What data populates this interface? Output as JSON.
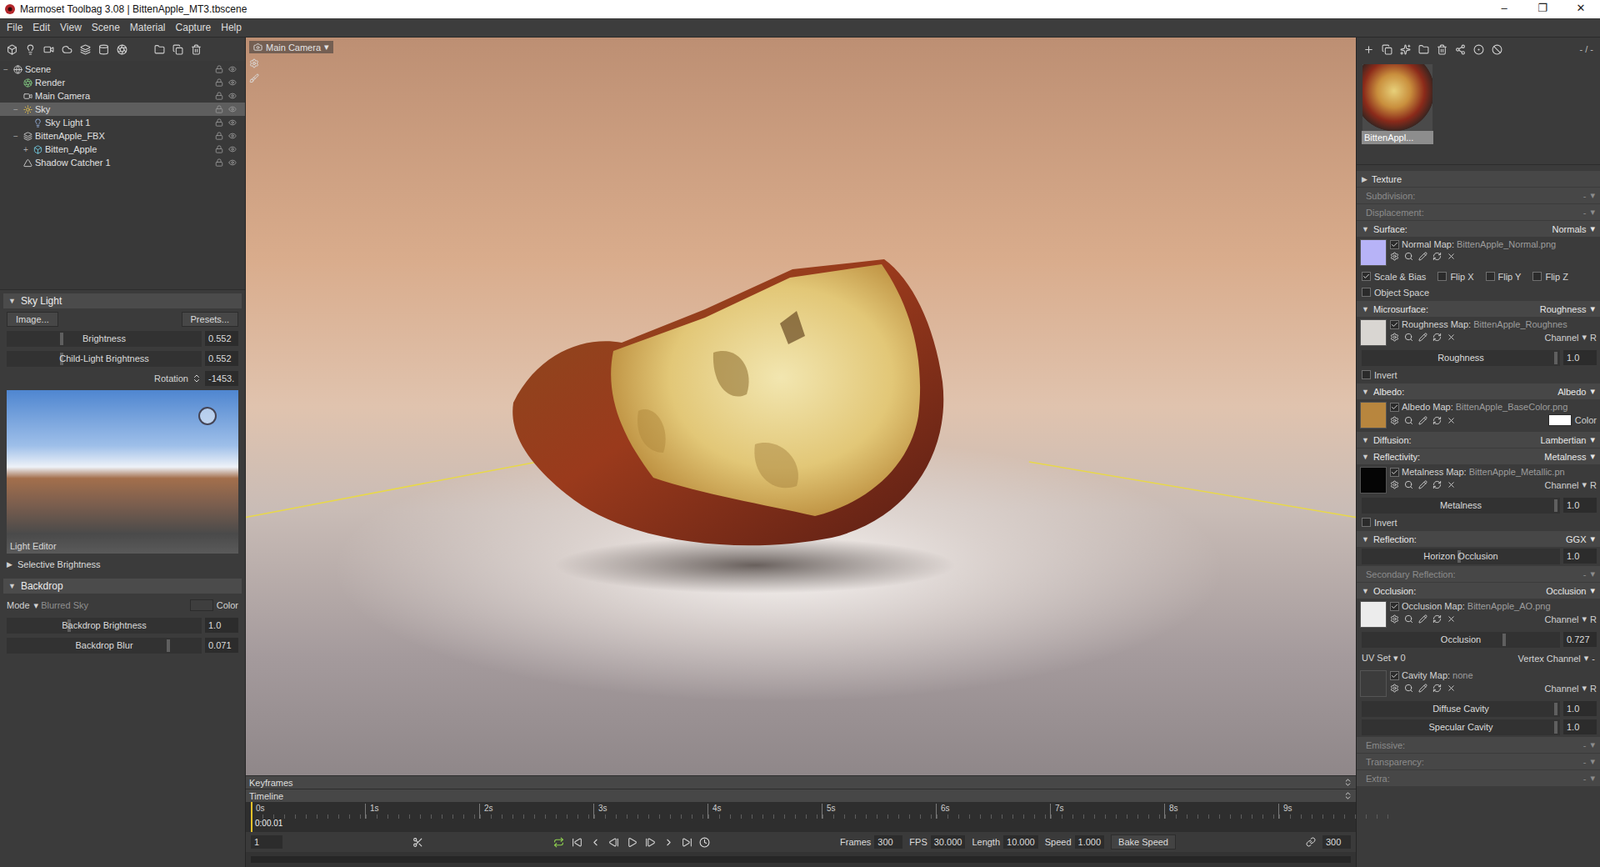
{
  "window": {
    "title": "Marmoset Toolbag 3.08 | BittenApple_MT3.tbscene",
    "controls": [
      "–",
      "❐",
      "✕"
    ]
  },
  "menu": [
    "File",
    "Edit",
    "View",
    "Scene",
    "Material",
    "Capture",
    "Help"
  ],
  "scene_tree": [
    {
      "label": "Scene",
      "depth": 0,
      "kind": "scene",
      "expander": "−",
      "selected": false
    },
    {
      "label": "Render",
      "depth": 1,
      "kind": "render",
      "expander": "",
      "selected": false
    },
    {
      "label": "Main Camera",
      "depth": 1,
      "kind": "camera",
      "expander": "",
      "selected": false
    },
    {
      "label": "Sky",
      "depth": 1,
      "kind": "sky",
      "expander": "−",
      "selected": true
    },
    {
      "label": "Sky Light 1",
      "depth": 2,
      "kind": "light",
      "expander": "",
      "selected": false
    },
    {
      "label": "BittenApple_FBX",
      "depth": 1,
      "kind": "group",
      "expander": "−",
      "selected": false
    },
    {
      "label": "Bitten_Apple",
      "depth": 2,
      "kind": "mesh",
      "expander": "+",
      "selected": false
    },
    {
      "label": "Shadow Catcher 1",
      "depth": 1,
      "kind": "shadow",
      "expander": "",
      "selected": false
    }
  ],
  "sky_light": {
    "arrow": "▼",
    "title": "Sky Light",
    "image_button": "Image...",
    "presets_button": "Presets...",
    "sliders": [
      {
        "label": "Brightness",
        "value": "0.552",
        "level": 0.28
      },
      {
        "label": "Child-Light Brightness",
        "value": "0.552",
        "level": 0.28
      }
    ],
    "rotation": {
      "label": "Rotation",
      "value": "-1453."
    },
    "preview_caption": "Light Editor",
    "selective": {
      "arrow": "▶",
      "label": "Selective Brightness",
      "expanded": false
    }
  },
  "backdrop": {
    "arrow": "▼",
    "title": "Backdrop",
    "mode_label": "Mode",
    "mode_arrow": "▾",
    "mode_value": "Blurred Sky",
    "color_label": "Color",
    "sliders": [
      {
        "label": "Backdrop Brightness",
        "value": "1.0",
        "level": 0.32
      },
      {
        "label": "Backdrop Blur",
        "value": "0.071",
        "level": 0.83
      }
    ]
  },
  "viewport": {
    "camera": "Main Camera",
    "camera_arrow": "▾"
  },
  "timeline": {
    "keyframes_label": "Keyframes",
    "timeline_label": "Timeline",
    "ticks": [
      "0s",
      "1s",
      "2s",
      "3s",
      "4s",
      "5s",
      "6s",
      "7s",
      "8s",
      "9s"
    ],
    "current": "0:00.01",
    "playhead_level": 0.0,
    "frame": "1",
    "fields": [
      {
        "label": "Frames",
        "value": "300"
      },
      {
        "label": "FPS",
        "value": "30.000"
      },
      {
        "label": "Length",
        "value": "10.000"
      },
      {
        "label": "Speed",
        "value": "1.000"
      }
    ],
    "bake_button": "Bake Speed",
    "end_frame": "300"
  },
  "material": {
    "page": "- / -",
    "name": "BittenAppl...",
    "selected": true,
    "channel_label": "Channel",
    "dropdown": "▾",
    "sections": [
      {
        "arrow": "▶",
        "label": "Texture",
        "value": "",
        "dropdown": "",
        "disabled": false,
        "rows": []
      },
      {
        "arrow": "",
        "label": "Subdivision:",
        "value": "-",
        "dropdown": "▾",
        "disabled": true,
        "rows": []
      },
      {
        "arrow": "",
        "label": "Displacement:",
        "value": "-",
        "dropdown": "▾",
        "disabled": true,
        "rows": []
      },
      {
        "arrow": "▼",
        "label": "Surface:",
        "value": "Normals",
        "dropdown": "▾",
        "disabled": false,
        "rows": [
          {
            "kind": "map",
            "label": "Normal Map:",
            "file": "BittenApple_Normal.png",
            "enabled": true,
            "color": "#b7b3f7",
            "channel": null,
            "swatch": null
          },
          {
            "kind": "checks",
            "items": [
              {
                "label": "Scale & Bias",
                "checked": true
              },
              {
                "label": "Flip X",
                "checked": false
              },
              {
                "label": "Flip Y",
                "checked": false
              },
              {
                "label": "Flip Z",
                "checked": false
              }
            ]
          },
          {
            "kind": "checks",
            "items": [
              {
                "label": "Object Space",
                "checked": false
              }
            ]
          }
        ]
      },
      {
        "arrow": "▼",
        "label": "Microsurface:",
        "value": "Roughness",
        "dropdown": "▾",
        "disabled": false,
        "rows": [
          {
            "kind": "map",
            "label": "Roughness Map:",
            "file": "BittenApple_Roughnes",
            "enabled": true,
            "color": "#d9d6d2",
            "channel": "R",
            "swatch": null
          },
          {
            "kind": "slider",
            "label": "Roughness",
            "value": "1.0",
            "level": 0.98
          },
          {
            "kind": "checks",
            "items": [
              {
                "label": "Invert",
                "checked": false
              }
            ]
          }
        ]
      },
      {
        "arrow": "▼",
        "label": "Albedo:",
        "value": "Albedo",
        "dropdown": "▾",
        "disabled": false,
        "rows": [
          {
            "kind": "map",
            "label": "Albedo Map:",
            "file": "BittenApple_BaseColor.png",
            "enabled": true,
            "color": "#b8863e",
            "channel": null,
            "swatch": {
              "label": "Color",
              "color": "#ffffff"
            }
          }
        ]
      },
      {
        "arrow": "▼",
        "label": "Diffusion:",
        "value": "Lambertian",
        "dropdown": "▾",
        "disabled": false,
        "rows": []
      },
      {
        "arrow": "▼",
        "label": "Reflectivity:",
        "value": "Metalness",
        "dropdown": "▾",
        "disabled": false,
        "rows": [
          {
            "kind": "map",
            "label": "Metalness Map:",
            "file": "BittenApple_Metallic.pn",
            "enabled": true,
            "color": "#050505",
            "channel": "R",
            "swatch": null
          },
          {
            "kind": "slider",
            "label": "Metalness",
            "value": "1.0",
            "level": 0.98
          },
          {
            "kind": "checks",
            "items": [
              {
                "label": "Invert",
                "checked": false
              }
            ]
          }
        ]
      },
      {
        "arrow": "▼",
        "label": "Reflection:",
        "value": "GGX",
        "dropdown": "▾",
        "disabled": false,
        "rows": [
          {
            "kind": "slider",
            "label": "Horizon Occlusion",
            "value": "1.0",
            "level": 0.49
          }
        ]
      },
      {
        "arrow": "",
        "label": "Secondary Reflection:",
        "value": "-",
        "dropdown": "▾",
        "disabled": true,
        "rows": []
      },
      {
        "arrow": "▼",
        "label": "Occlusion:",
        "value": "Occlusion",
        "dropdown": "▾",
        "disabled": false,
        "rows": [
          {
            "kind": "map",
            "label": "Occlusion Map:",
            "file": "BittenApple_AO.png",
            "enabled": true,
            "color": "#ececec",
            "channel": "R",
            "swatch": null
          },
          {
            "kind": "slider",
            "label": "Occlusion",
            "value": "0.727",
            "level": 0.72
          },
          {
            "kind": "uv",
            "label": "UV Set",
            "value": "0",
            "vertex_label": "Vertex Channel",
            "vertex_value": "-"
          },
          {
            "kind": "map",
            "label": "Cavity Map:",
            "file": "none",
            "enabled": true,
            "color": "#3c3c3c",
            "channel": "R",
            "swatch": null
          },
          {
            "kind": "slider",
            "label": "Diffuse Cavity",
            "value": "1.0",
            "level": 0.98
          },
          {
            "kind": "slider",
            "label": "Specular Cavity",
            "value": "1.0",
            "level": 0.98
          }
        ]
      },
      {
        "arrow": "",
        "label": "Emissive:",
        "value": "-",
        "dropdown": "▾",
        "disabled": true,
        "rows": []
      },
      {
        "arrow": "",
        "label": "Transparency:",
        "value": "-",
        "dropdown": "▾",
        "disabled": true,
        "rows": []
      },
      {
        "arrow": "",
        "label": "Extra:",
        "value": "-",
        "dropdown": "▾",
        "disabled": true,
        "rows": []
      }
    ]
  }
}
